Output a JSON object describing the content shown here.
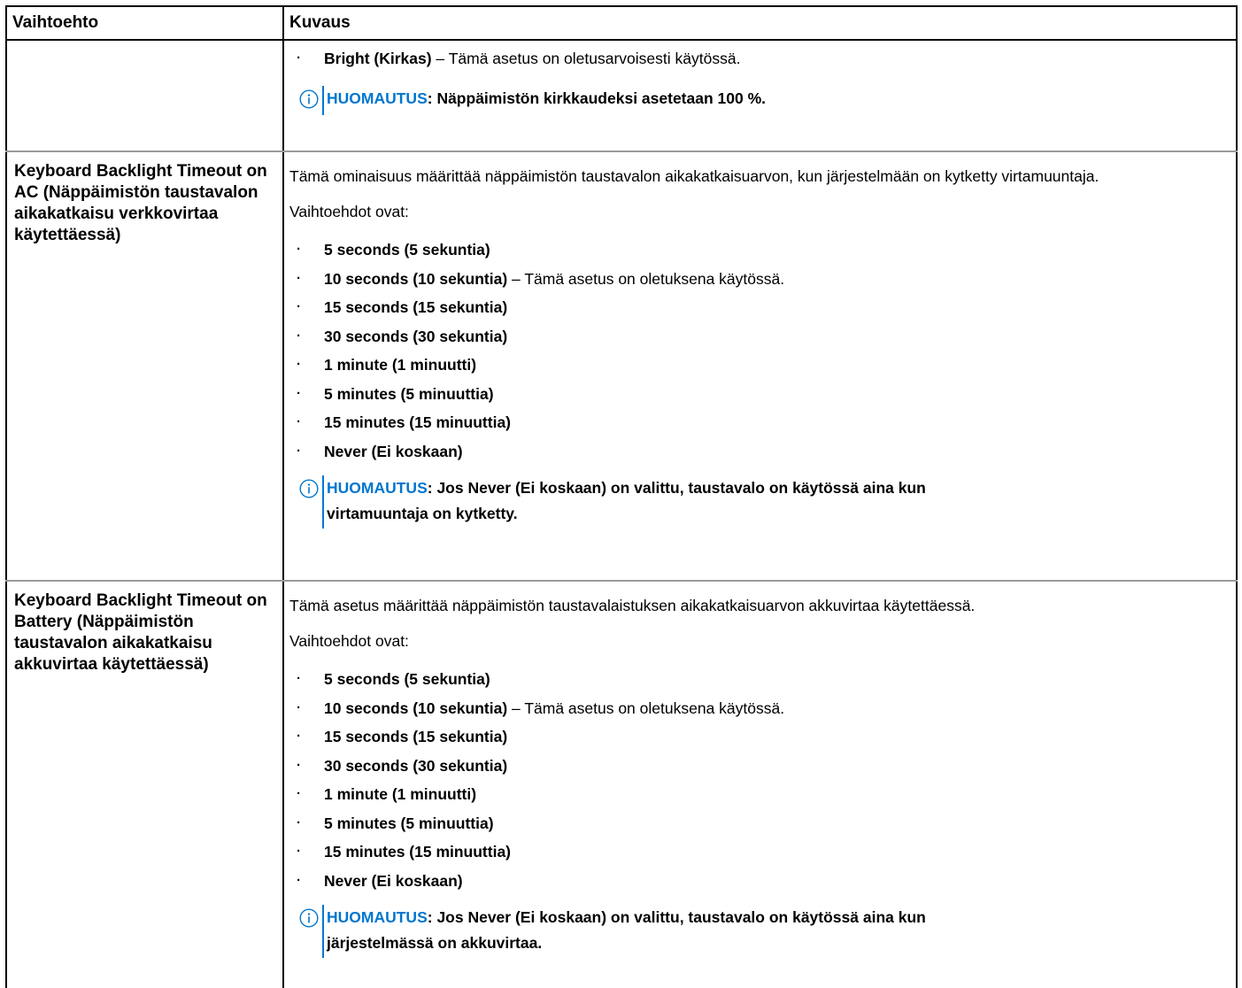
{
  "table": {
    "header": {
      "option": "Vaihtoehto",
      "description": "Kuvaus"
    },
    "row0": {
      "option": "",
      "bullets": [
        {
          "name": "Bright (Kirkas)",
          "suffix": " – Tämä asetus on oletusarvoisesti käytössä."
        }
      ],
      "note_keyword": "HUOMAUTUS",
      "note_text": ": Näppäimistön kirkkaudeksi asetetaan 100 %."
    },
    "row1": {
      "option": "Keyboard Backlight Timeout on AC (Näppäimistön taustavalon aikakatkaisu verkkovirtaa käytettäessä)",
      "description": "Tämä ominaisuus määrittää näppäimistön taustavalon aikakatkaisuarvon, kun järjestelmään on kytketty virtamuuntaja.",
      "options_intro": "Vaihtoehdot ovat:",
      "bullets": [
        {
          "name": "5 seconds (5 sekuntia)",
          "suffix": ""
        },
        {
          "name": "10 seconds (10 sekuntia)",
          "suffix": " – Tämä asetus on oletuksena käytössä."
        },
        {
          "name": "15 seconds (15 sekuntia)",
          "suffix": ""
        },
        {
          "name": "30 seconds (30 sekuntia)",
          "suffix": ""
        },
        {
          "name": "1 minute (1 minuutti)",
          "suffix": ""
        },
        {
          "name": "5 minutes (5 minuuttia)",
          "suffix": ""
        },
        {
          "name": "15 minutes (15 minuuttia)",
          "suffix": ""
        },
        {
          "name": "Never (Ei koskaan)",
          "suffix": ""
        }
      ],
      "note_keyword": "HUOMAUTUS",
      "note_line1": ": Jos Never (Ei koskaan) on valittu, taustavalo on käytössä aina kun",
      "note_line2": "virtamuuntaja on kytketty."
    },
    "row2": {
      "option": "Keyboard Backlight Timeout on Battery (Näppäimistön taustavalon aikakatkaisu akkuvirtaa käytettäessä)",
      "description": "Tämä asetus määrittää näppäimistön taustavalaistuksen aikakatkaisuarvon akkuvirtaa käytettäessä.",
      "options_intro": "Vaihtoehdot ovat:",
      "bullets": [
        {
          "name": "5 seconds (5 sekuntia)",
          "suffix": ""
        },
        {
          "name": "10 seconds (10 sekuntia)",
          "suffix": " – Tämä asetus on oletuksena käytössä."
        },
        {
          "name": "15 seconds (15 sekuntia)",
          "suffix": ""
        },
        {
          "name": "30 seconds (30 sekuntia)",
          "suffix": ""
        },
        {
          "name": "1 minute (1 minuutti)",
          "suffix": ""
        },
        {
          "name": "5 minutes (5 minuuttia)",
          "suffix": ""
        },
        {
          "name": "15 minutes (15 minuuttia)",
          "suffix": ""
        },
        {
          "name": "Never (Ei koskaan)",
          "suffix": ""
        }
      ],
      "note_keyword": "HUOMAUTUS",
      "note_line1": ": Jos Never (Ei koskaan) on valittu, taustavalo on käytössä aina kun",
      "note_line2": "järjestelmässä on akkuvirtaa."
    }
  },
  "icons": {
    "note": "info-circle-icon"
  },
  "colors": {
    "note_accent": "#0076ce",
    "row_border": "#9a9a9a"
  }
}
